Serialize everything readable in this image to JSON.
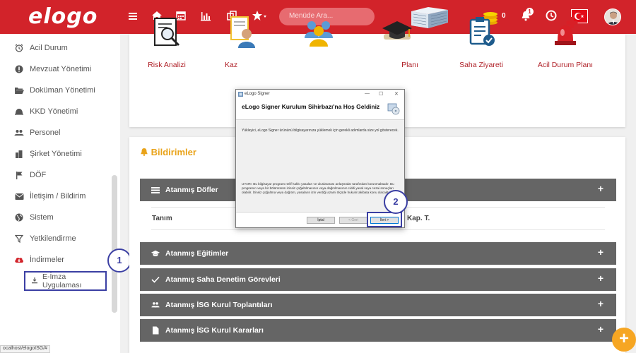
{
  "topbar": {
    "logo": "elogo",
    "search_placeholder": "Menüde Ara...",
    "coin_count": "0",
    "notification_count": "1"
  },
  "sidebar": {
    "items": [
      {
        "label": "Acil Durum",
        "icon": "alarm-clock-icon"
      },
      {
        "label": "Mevzuat Yönetimi",
        "icon": "exclamation-icon"
      },
      {
        "label": "Doküman Yönetimi",
        "icon": "folder-open-icon"
      },
      {
        "label": "KKD Yönetimi",
        "icon": "helmet-icon"
      },
      {
        "label": "Personel",
        "icon": "users-icon"
      },
      {
        "label": "Şirket Yönetimi",
        "icon": "building-icon"
      },
      {
        "label": "DÖF",
        "icon": "flag-icon"
      },
      {
        "label": "İletişim / Bildirim",
        "icon": "envelope-icon"
      },
      {
        "label": "Sistem",
        "icon": "globe-icon"
      },
      {
        "label": "Yetkilendirme",
        "icon": "filter-icon"
      },
      {
        "label": "İndirmeler",
        "icon": "cloud-download-icon"
      }
    ],
    "sub_item": "E-İmza Uygulaması"
  },
  "tiles": [
    {
      "label": "Risk Analizi"
    },
    {
      "label": "Kaz"
    },
    {
      "label": ""
    },
    {
      "label": "Planı"
    },
    {
      "label": "Saha Ziyareti"
    },
    {
      "label": "Acil Durum Planı"
    }
  ],
  "bildirimler": {
    "title": "Bildirimler",
    "bars": [
      {
        "label": "Atanmış Döfler"
      },
      {
        "label": "Atanmış Eğitimler"
      },
      {
        "label": "Atanmış Saha Denetim Görevleri"
      },
      {
        "label": "Atanmış İSG Kurul Toplantıları"
      },
      {
        "label": "Atanmış İSG Kurul Kararları"
      }
    ],
    "col_tanim": "Tanım",
    "col_kap": "Kap. T."
  },
  "annotations": {
    "step1": "1",
    "step2": "2"
  },
  "installer": {
    "window_title": "eLogo Signer",
    "header": "eLogo Signer Kurulum Sihirbazı'na Hoş Geldiniz",
    "intro": "Yükleyici, eLogo Signer ürününü bilgisayarınıza yüklemek için gerekli adımlarda size yol gösterecek.",
    "warning": "UYARI: Bu bilgisayar programı telif hakkı yasaları ve uluslararası anlaşmalar tarafından korunmaktadır. Bu programın veya bir bölümünün izinsiz çoğaltılmasının veya dağıtılmasının ciddi yasal veya cezai sonuçları olabilir. İzinsiz çoğaltma veya dağıtım, yasaların izin verdiği azami ölçüde hukuki takibata konu olacaktır.",
    "btn_cancel": "İptal",
    "btn_back": "< Geri",
    "btn_next": "İleri >"
  },
  "status_url": "ocalhost/elogoISG/#",
  "colors": {
    "brand_red": "#d2232a",
    "annotation": "#3b3fa3",
    "accent": "#e9a31a"
  }
}
